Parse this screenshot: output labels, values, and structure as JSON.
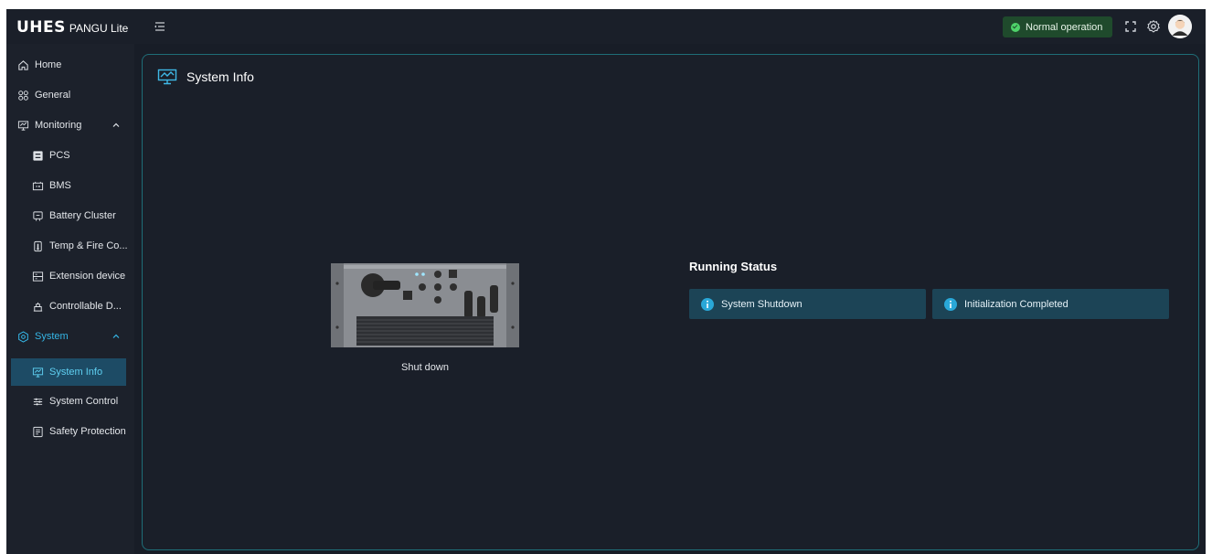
{
  "header": {
    "logo_main": "UHES",
    "logo_sub": "PANGU Lite",
    "status_label": "Normal operation",
    "colors": {
      "status_bg": "#1f4a2c",
      "status_dot": "#4ed36a"
    },
    "icons": [
      "menu-collapse-icon",
      "fullscreen-icon",
      "settings-icon",
      "user-avatar"
    ]
  },
  "sidebar": {
    "items": [
      {
        "label": "Home",
        "icon": "home-icon"
      },
      {
        "label": "General",
        "icon": "general-icon"
      },
      {
        "label": "Monitoring",
        "icon": "monitor-icon",
        "expanded": true
      },
      {
        "label": "PCS",
        "icon": "pcs-icon"
      },
      {
        "label": "BMS",
        "icon": "bms-icon"
      },
      {
        "label": "Battery Cluster",
        "icon": "battery-cluster-icon"
      },
      {
        "label": "Temp & Fire Co...",
        "icon": "thermometer-icon"
      },
      {
        "label": "Extension device",
        "icon": "extension-device-icon"
      },
      {
        "label": "Controllable D...",
        "icon": "controllable-device-icon"
      },
      {
        "label": "System",
        "icon": "system-gear-icon",
        "expanded": true,
        "active": true
      },
      {
        "label": "System Info",
        "icon": "system-info-icon",
        "selected": true
      },
      {
        "label": "System Control",
        "icon": "system-control-icon"
      },
      {
        "label": "Safety Protection",
        "icon": "safety-protection-icon"
      }
    ],
    "colors": {
      "active_text": "#35b6e6",
      "selected_bg": "#1d4b65"
    }
  },
  "main": {
    "title": "System Info",
    "device_status": "Shut down",
    "running_status": {
      "title": "Running Status",
      "items": [
        "System Shutdown",
        "Initialization Completed"
      ]
    },
    "colors": {
      "card_bg": "#1c4456",
      "info_icon": "#29a8d8",
      "panel_border": "#1f6e78"
    }
  }
}
